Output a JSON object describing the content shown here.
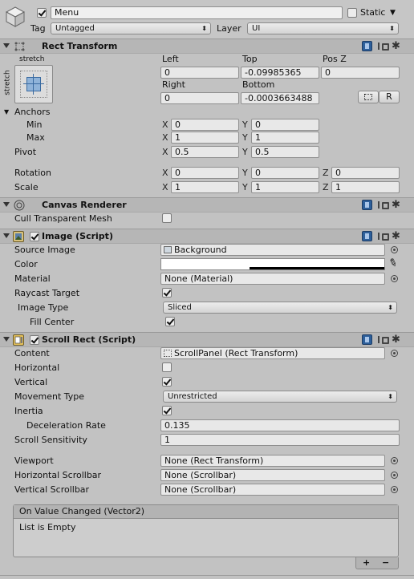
{
  "header": {
    "object_name": "Menu",
    "static_label": "Static",
    "tag_label": "Tag",
    "tag_value": "Untagged",
    "layer_label": "Layer",
    "layer_value": "UI"
  },
  "rect_transform": {
    "title": "Rect Transform",
    "anchor_preset_top": "stretch",
    "anchor_preset_side": "stretch",
    "left_label": "Left",
    "top_label": "Top",
    "posz_label": "Pos Z",
    "left_value": "0",
    "top_value": "-0.09985365",
    "posz_value": "0",
    "right_label": "Right",
    "bottom_label": "Bottom",
    "right_value": "0",
    "bottom_value": "-0.0003663488",
    "raw_button": "R",
    "anchors_label": "Anchors",
    "min_label": "Min",
    "max_label": "Max",
    "min_x": "0",
    "min_y": "0",
    "max_x": "1",
    "max_y": "1",
    "pivot_label": "Pivot",
    "pivot_x": "0.5",
    "pivot_y": "0.5",
    "rotation_label": "Rotation",
    "rot_x": "0",
    "rot_y": "0",
    "rot_z": "0",
    "scale_label": "Scale",
    "scale_x": "1",
    "scale_y": "1",
    "scale_z": "1",
    "x": "X",
    "y": "Y",
    "z": "Z"
  },
  "canvas_renderer": {
    "title": "Canvas Renderer",
    "cull_label": "Cull Transparent Mesh"
  },
  "image": {
    "title": "Image (Script)",
    "source_label": "Source Image",
    "source_value": "Background",
    "color_label": "Color",
    "color_value": "#ffffff",
    "material_label": "Material",
    "material_value": "None (Material)",
    "raycast_label": "Raycast Target",
    "image_type_label": "Image Type",
    "image_type_value": "Sliced",
    "fill_center_label": "Fill Center"
  },
  "scroll_rect": {
    "title": "Scroll Rect (Script)",
    "content_label": "Content",
    "content_value": "ScrollPanel (Rect Transform)",
    "horizontal_label": "Horizontal",
    "vertical_label": "Vertical",
    "movement_label": "Movement Type",
    "movement_value": "Unrestricted",
    "inertia_label": "Inertia",
    "decel_label": "Deceleration Rate",
    "decel_value": "0.135",
    "sensitivity_label": "Scroll Sensitivity",
    "sensitivity_value": "1",
    "viewport_label": "Viewport",
    "viewport_value": "None (Rect Transform)",
    "hscroll_label": "Horizontal Scrollbar",
    "hscroll_value": "None (Scrollbar)",
    "vscroll_label": "Vertical Scrollbar",
    "vscroll_value": "None (Scrollbar)",
    "event_title": "On Value Changed (Vector2)",
    "event_empty": "List is Empty",
    "add_label": "+",
    "remove_label": "−"
  },
  "icons": {
    "gameobject": "cube-icon",
    "rect_transform": "rect-transform-icon",
    "canvas_renderer": "canvas-renderer-icon",
    "image": "image-script-icon",
    "scroll_rect": "scroll-rect-icon",
    "help": "help-book-icon",
    "preset": "preset-icon",
    "settings": "gear-icon",
    "object_picker": "object-picker-icon",
    "eyedropper": "eyedropper-icon",
    "blueprint": "blueprint-mode-icon"
  }
}
